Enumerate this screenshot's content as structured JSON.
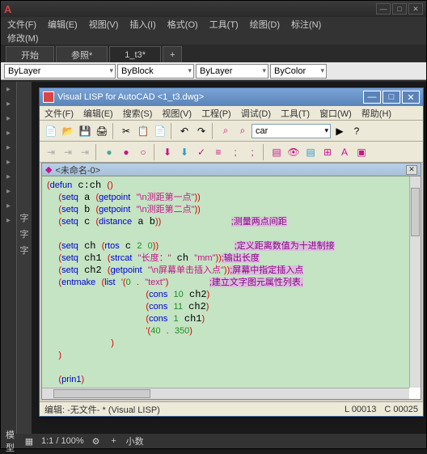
{
  "outer": {
    "menu": [
      "文件(F)",
      "编辑(E)",
      "视图(V)",
      "插入(I)",
      "格式(O)",
      "工具(T)",
      "绘图(D)",
      "标注(N)"
    ],
    "sub": "修改(M)",
    "tabs": [
      "开始",
      "参照*",
      "1_t3*"
    ],
    "tab_plus": "+",
    "layers": {
      "l1": "ByLayer",
      "l2": "ByBlock",
      "l3": "ByLayer",
      "l4": "ByColor"
    },
    "left_labels": [
      "字",
      "字",
      "字"
    ],
    "status": {
      "model": "模型",
      "scale": "1:1 / 100%",
      "deg": "小数",
      "coords": ""
    }
  },
  "vlisp": {
    "title": "Visual LISP for AutoCAD <1_t3.dwg>",
    "menu": [
      "文件(F)",
      "编辑(E)",
      "搜索(S)",
      "视图(V)",
      "工程(P)",
      "调试(D)",
      "工具(T)",
      "窗口(W)",
      "帮助(H)"
    ],
    "combo": "car",
    "doc_title": "<未命名-0>",
    "code_lines": [
      {
        "t": "(defun c:ch ()",
        "cls": ""
      },
      {
        "t": "  (setq a (getpoint \"\\n测距第一点\"))",
        "cls": ""
      },
      {
        "t": "  (setq b (getpoint \"\\n测距第二点\"))",
        "cls": ""
      },
      {
        "t": "  (setq c (distance a b))            ",
        "cmt": ";测量两点间距"
      },
      {
        "t": "",
        "cls": ""
      },
      {
        "t": "  (setq ch (rtos c 2 0))             ",
        "cmt": ";定义距离数值为十进制接"
      },
      {
        "t": "  (setq ch1 (strcat \"长度：\" ch \"mm\"))",
        "cmt": ";输出长度"
      },
      {
        "t": "  (setq ch2 (getpoint \"\\n屏幕单击插入点\"))",
        "cmt": ";屏幕中指定插入点"
      },
      {
        "t": "  (entmake (list '(0 . \"text\")       ",
        "cmt": ";建立文字图元属性列表,"
      },
      {
        "t": "                 (cons 10 ch2)",
        "cls": ""
      },
      {
        "t": "                 (cons 11 ch2)",
        "cls": ""
      },
      {
        "t": "                 (cons 1 ch1)",
        "cls": ""
      },
      {
        "t": "                 '(40 . 350)",
        "cls": ""
      },
      {
        "t": "           )",
        "cls": ""
      },
      {
        "t": "  )",
        "cls": ""
      },
      {
        "t": "",
        "cls": ""
      },
      {
        "t": "  (prin1)",
        "cls": ""
      },
      {
        "t": ")",
        "cls": ""
      }
    ],
    "status": {
      "left": "编辑: -无文件- * (Visual LISP)",
      "line": "L 00013",
      "col": "C 00025"
    }
  }
}
